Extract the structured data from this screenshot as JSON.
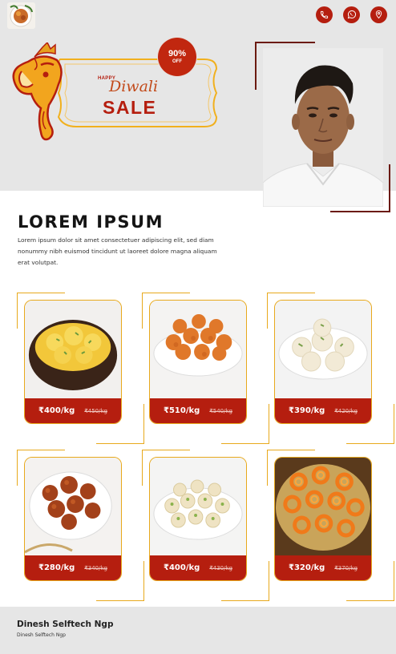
{
  "header": {
    "icons": [
      "phone-icon",
      "whatsapp-icon",
      "location-pin-icon"
    ],
    "accent_color": "#b51e0f"
  },
  "banner": {
    "happy": "HAPPY",
    "diwali": "Diwali",
    "sale": "SALE",
    "badge_percent": "90%",
    "badge_off": "OFF"
  },
  "content": {
    "title": "LOREM IPSUM",
    "description": "Lorem ipsum dolor sit amet consectetuer adipiscing elit, sed diam nonummy nibh euismod tincidunt ut laoreet dolore magna aliquam erat volutpat."
  },
  "products": [
    {
      "price": "₹400/kg",
      "old_price": "₹450/kg",
      "dish": "rasmalai"
    },
    {
      "price": "₹510/kg",
      "old_price": "₹540/kg",
      "dish": "motichoor-ladoo"
    },
    {
      "price": "₹390/kg",
      "old_price": "₹420/kg",
      "dish": "rasgulla"
    },
    {
      "price": "₹280/kg",
      "old_price": "₹340/kg",
      "dish": "gulab-jamun"
    },
    {
      "price": "₹400/kg",
      "old_price": "₹430/kg",
      "dish": "pista-peda"
    },
    {
      "price": "₹320/kg",
      "old_price": "₹370/kg",
      "dish": "jalebi"
    }
  ],
  "footer": {
    "name": "Dinesh Selftech Ngp",
    "subtitle": "Dinesh Selftech Ngp"
  }
}
